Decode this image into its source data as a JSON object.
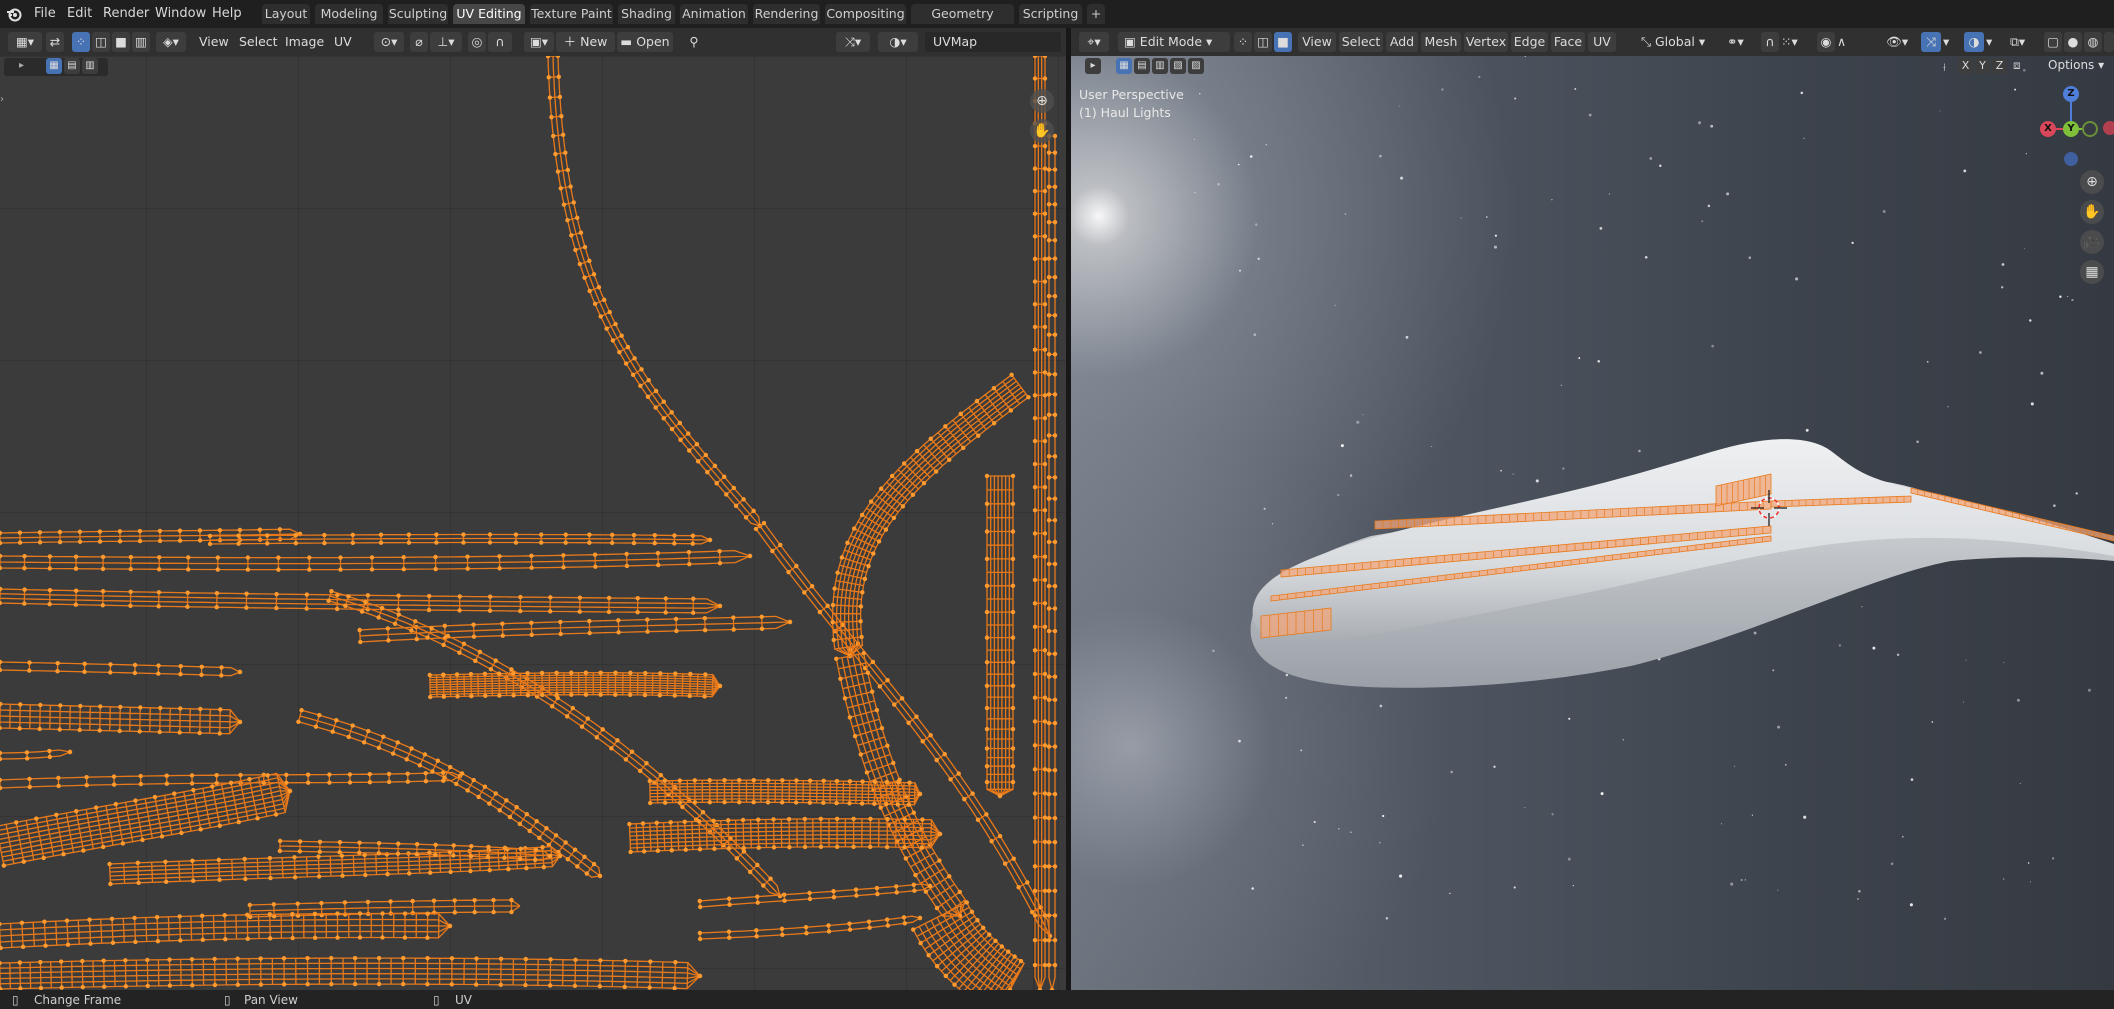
{
  "menus": {
    "file": "File",
    "edit": "Edit",
    "render": "Render",
    "window": "Window",
    "help": "Help"
  },
  "workspaces": {
    "tabs": [
      "Layout",
      "Modeling",
      "Sculpting",
      "UV Editing",
      "Texture Paint",
      "Shading",
      "Animation",
      "Rendering",
      "Compositing",
      "Geometry Nodes",
      "Scripting"
    ],
    "active": "UV Editing",
    "add": "+"
  },
  "uv_editor": {
    "menus": {
      "view": "View",
      "select": "Select",
      "image": "Image",
      "uv": "UV"
    },
    "new_button": "New",
    "open_button": "Open",
    "uvmap": "UVMap"
  },
  "viewport": {
    "mode": "Edit Mode",
    "menus": {
      "view": "View",
      "select": "Select",
      "add": "Add",
      "mesh": "Mesh",
      "vertex": "Vertex",
      "edge": "Edge",
      "face": "Face",
      "uv": "UV"
    },
    "orientation": "Global",
    "axis_x": "X",
    "axis_y": "Y",
    "axis_z": "Z",
    "options": "Options",
    "perspective_label": "User Perspective",
    "object_label": "(1) Haul Lights",
    "gizmo": {
      "x": "X",
      "y": "Y",
      "z": "Z"
    }
  },
  "statusbar": {
    "change_frame": "Change Frame",
    "pan_view": "Pan View",
    "uv": "UV"
  },
  "colors": {
    "accent": "#4772b3",
    "uv_edge": "#e8791a",
    "uv_vertex": "#ff9a2e",
    "selected_face": "#f2a57a"
  }
}
